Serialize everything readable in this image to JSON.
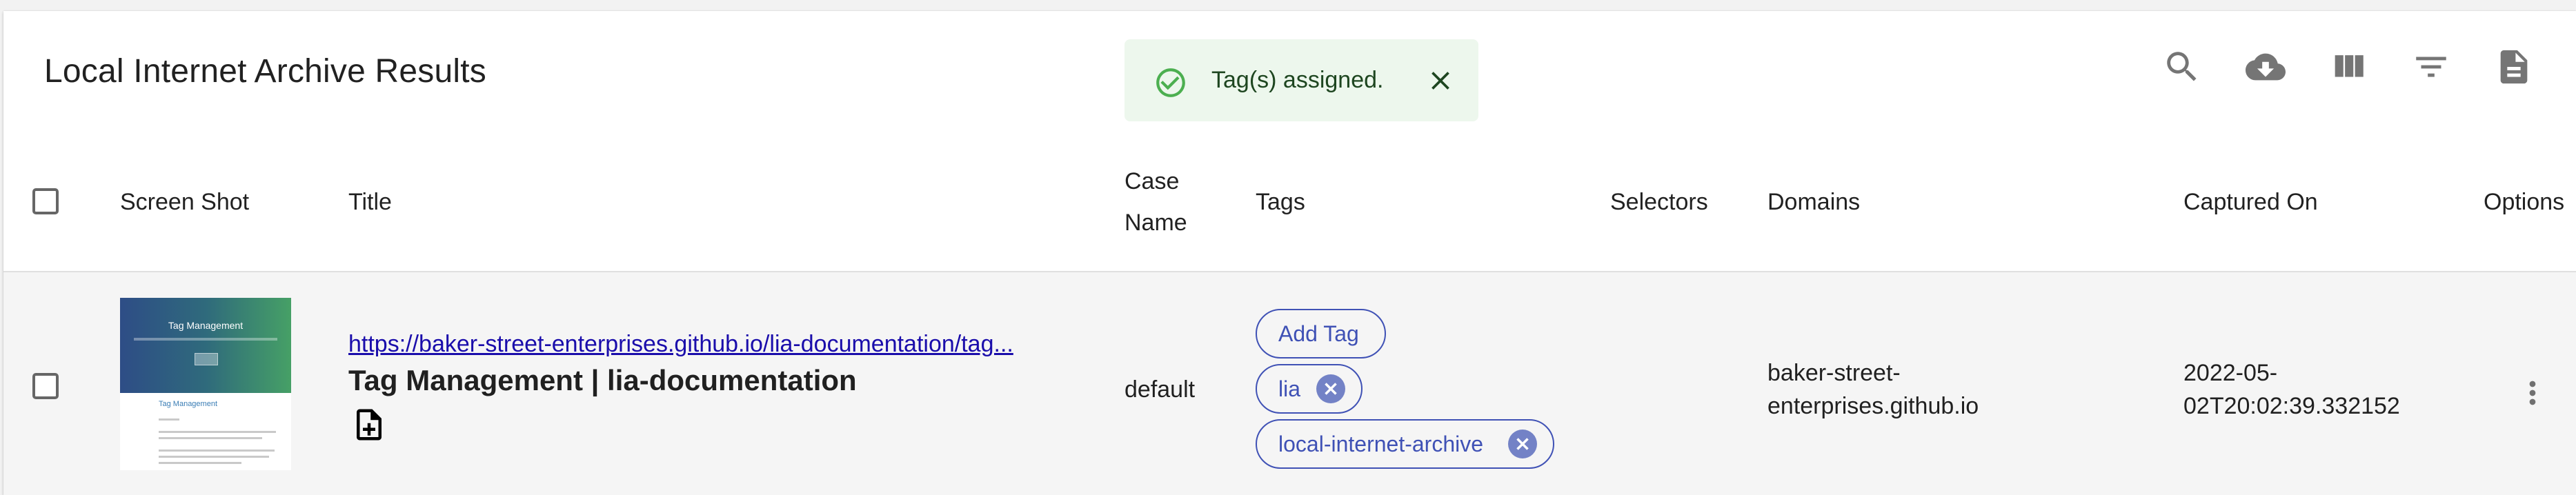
{
  "page": {
    "title": "Local Internet Archive Results"
  },
  "snackbar": {
    "message": "Tag(s) assigned.",
    "icon": "check-circle-outline-icon",
    "close_icon": "close-icon"
  },
  "toolbar": {
    "icons": [
      "search-icon",
      "cloud-download-icon",
      "view-column-icon",
      "filter-list-icon",
      "description-icon"
    ]
  },
  "table": {
    "columns": [
      "Screen Shot",
      "Title",
      "Case",
      "Name",
      "Tags",
      "Selectors",
      "Domains",
      "Captured On",
      "Options"
    ],
    "rows": [
      {
        "thumbnail": {
          "heading": "Tag Management",
          "section": "Tag Management"
        },
        "url": "https://baker-street-enterprises.github.io/lia-documentation/tag...",
        "page_title": "Tag Management | lia-documentation",
        "case_name": "default",
        "tags": {
          "add_label": "Add Tag",
          "items": [
            "lia",
            "local-internet-archive"
          ]
        },
        "selectors": "",
        "domain_line1": "baker-street-",
        "domain_line2": "enterprises.github.io",
        "captured_line1": "2022-05-",
        "captured_line2": "02T20:02:39.332152"
      }
    ]
  },
  "colors": {
    "primary": "#3f51b5",
    "chip_delete": "#7382c6",
    "success_bg": "#edf7ed",
    "success_icon": "#4caf50",
    "link": "#1a0dab"
  }
}
